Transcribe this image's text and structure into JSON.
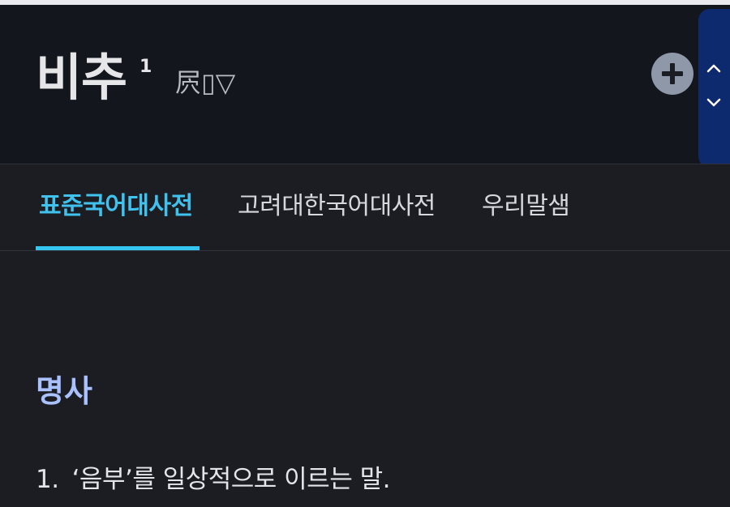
{
  "header": {
    "headword": "비추",
    "homonym_number": "1",
    "hanja": "屄▯▽",
    "add_button_icon": "plus-icon",
    "scroll_up_icon": "chevron-up-icon",
    "scroll_down_icon": "chevron-down-icon"
  },
  "tabs": [
    {
      "label": "표준국어대사전",
      "active": true
    },
    {
      "label": "고려대한국어대사전",
      "active": false
    },
    {
      "label": "우리말샘",
      "active": false
    }
  ],
  "entry": {
    "part_of_speech": "명사",
    "definitions": [
      {
        "number": "1.",
        "text": "‘음부’를 일상적으로 이르는 말."
      }
    ]
  },
  "colors": {
    "accent": "#34c5f0",
    "pos_label": "#a9c1ff",
    "header_bg": "#13161c",
    "body_bg": "#1b1d22",
    "scroll_panel": "#0d2a6e"
  }
}
